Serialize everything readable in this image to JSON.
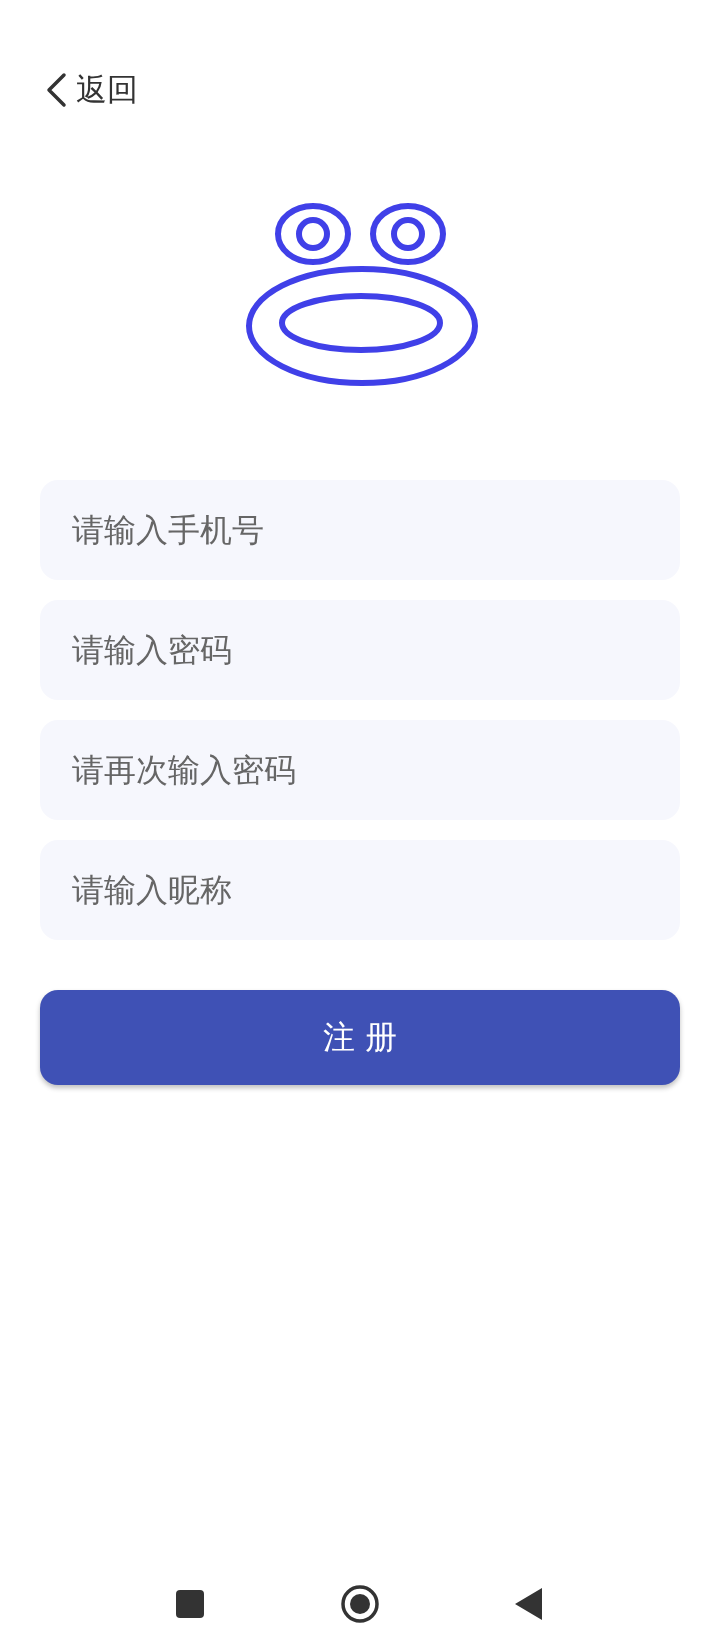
{
  "back": {
    "label": "返回"
  },
  "fields": [
    {
      "placeholder": "请输入手机号"
    },
    {
      "placeholder": "请输入密码"
    },
    {
      "placeholder": "请再次输入密码"
    },
    {
      "placeholder": "请输入昵称"
    }
  ],
  "submit": {
    "label": "注 册"
  }
}
